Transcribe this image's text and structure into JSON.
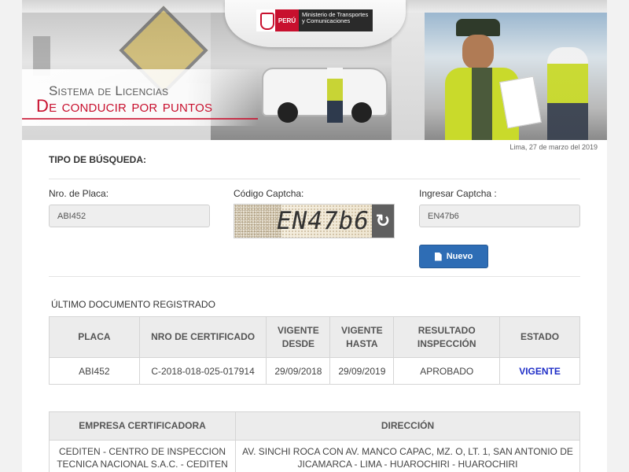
{
  "header": {
    "logo_country": "PERÚ",
    "logo_ministry": "Ministerio de Transportes y Comunicaciones",
    "title_line1": "Sistema de Licencias",
    "title_line2": "De conducir por puntos"
  },
  "date_text": "Lima, 27 de marzo del 2019",
  "search": {
    "type_label": "TIPO DE BÚSQUEDA:",
    "plate_label": "Nro. de Placa:",
    "plate_value": "ABI452",
    "captcha_label": "Código Captcha:",
    "captcha_text": "EN47b6",
    "captcha_input_label": "Ingresar Captcha :",
    "captcha_input_value": "EN47b6",
    "new_button": "Nuevo"
  },
  "last_document": {
    "title": "ÚLTIMO DOCUMENTO REGISTRADO",
    "headers": [
      "PLACA",
      "NRO DE CERTIFICADO",
      "VIGENTE DESDE",
      "VIGENTE HASTA",
      "RESULTADO INSPECCIÓN",
      "ESTADO"
    ],
    "row": [
      "ABI452",
      "C-2018-018-025-017914",
      "29/09/2018",
      "29/09/2019",
      "APROBADO",
      "VIGENTE"
    ]
  },
  "company": {
    "headers": [
      "EMPRESA CERTIFICADORA",
      "DIRECCIÓN"
    ],
    "row": [
      "CEDITEN - CENTRO DE INSPECCION TECNICA NACIONAL S.A.C. - CEDITEN",
      "AV. SINCHI ROCA CON AV. MANCO CAPAC, MZ. O, LT. 1, SAN ANTONIO DE JICAMARCA - LIMA - HUAROCHIRI - HUAROCHIRI"
    ]
  },
  "colors": {
    "accent_red": "#c8102e",
    "button_blue": "#2e6db5",
    "status_blue": "#1f2ec7"
  },
  "icons": {
    "refresh": "refresh-icon",
    "new": "file-icon"
  }
}
